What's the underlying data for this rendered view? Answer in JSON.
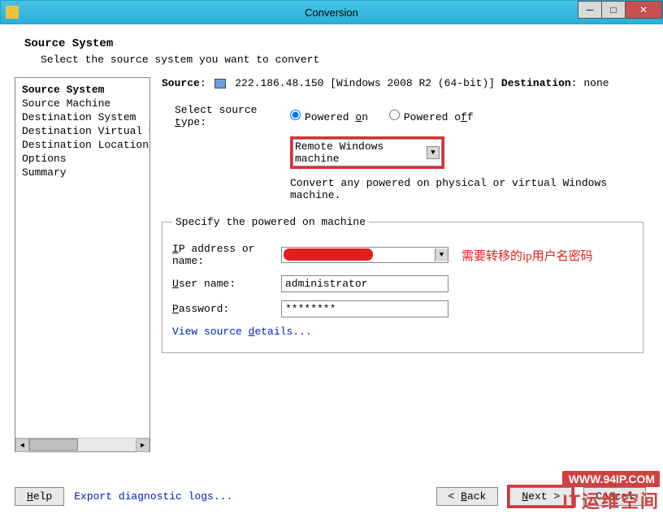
{
  "window": {
    "title": "Conversion",
    "min": "─",
    "max": "□",
    "close": "✕"
  },
  "header": {
    "title": "Source System",
    "subtitle": "Select the source system you want to convert"
  },
  "sidebar": {
    "items": [
      "Source System",
      "Source Machine",
      "Destination System",
      "Destination Virtual M",
      "Destination Location",
      "Options",
      "Summary"
    ]
  },
  "main": {
    "source_label": "Source",
    "source_value": "222.186.48.150 [Windows 2008 R2 (64-bit)]",
    "dest_label": "Destination",
    "dest_value": "none",
    "select_type_label": "Select source type:",
    "radio_on": "Powered on",
    "radio_off": "Powered off",
    "dropdown": "Remote Windows machine",
    "hint": "Convert any powered on physical or virtual Windows machine.",
    "fieldset_legend": "Specify the powered on machine",
    "ip_label": "IP address or name:",
    "user_label": "User name:",
    "user_value": "administrator",
    "pass_label": "Password:",
    "pass_value": "********",
    "annotation": "需要转移的ip用户名密码",
    "details_link": "View source details..."
  },
  "footer": {
    "help": "Help",
    "export": "Export diagnostic logs...",
    "back": "< Back",
    "next": "Next >",
    "cancel": "Cancel"
  },
  "watermark": {
    "url": "WWW.94IP.COM",
    "text": "IT运维空间"
  }
}
